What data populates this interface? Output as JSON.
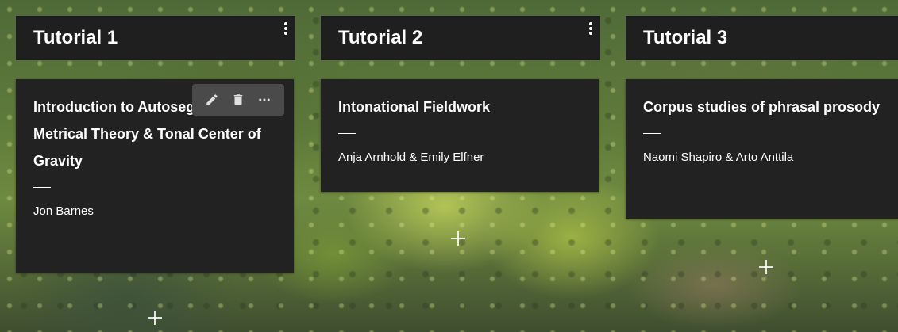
{
  "board": {
    "lists": [
      {
        "title": "Tutorial 1",
        "menu_icon": "vertical-dots-icon",
        "card": {
          "title": "Introduction to Autosegmental-Metrical Theory & Tonal Center of Gravity",
          "divider": "",
          "authors": "Jon Barnes",
          "actions": [
            "pencil-edit-icon",
            "trash-delete-icon",
            "more-horizontal-icon"
          ]
        }
      },
      {
        "title": "Tutorial 2",
        "menu_icon": "vertical-dots-icon",
        "card": {
          "title": "Intonational Fieldwork",
          "divider": "",
          "authors": "Anja Arnhold & Emily Elfner"
        }
      },
      {
        "title": "Tutorial 3",
        "menu_icon": "vertical-dots-icon",
        "card": {
          "title": "Corpus studies of phrasal prosody",
          "divider": "",
          "authors": "Naomi Shapiro & Arto Anttila"
        }
      }
    ],
    "add_icon": "plus-icon",
    "colors": {
      "header_bg": "#1f1f1f",
      "card_bg": "#222222",
      "actions_bg": "#4a4a4a",
      "text": "#ffffff"
    }
  }
}
